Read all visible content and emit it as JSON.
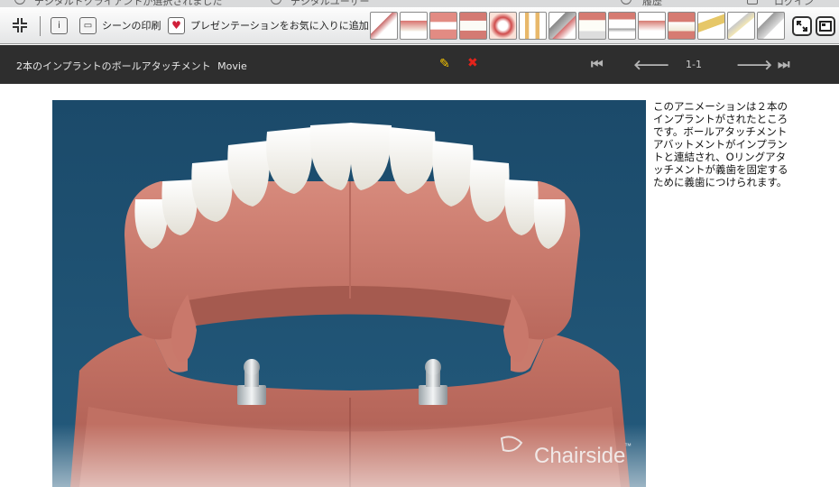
{
  "status_bar": {
    "left_text": "デジタルドクライアントが選択されました",
    "user_text": "デジタルユーザー",
    "history_text": "履歴",
    "login_text": "ログイン"
  },
  "toolbar": {
    "print_label": "シーンの印刷",
    "favorite_label": "プレゼンテーションをお気に入りに追加",
    "thumbnail_icons": [
      "dental-scene-1",
      "dental-scene-2",
      "dental-scene-3",
      "dental-scene-4",
      "dental-scene-5",
      "dental-scene-6",
      "dental-scene-7",
      "dental-scene-8",
      "dental-scene-9",
      "dental-scene-10",
      "dental-scene-11",
      "dental-scene-12",
      "dental-scene-13",
      "dental-scene-14"
    ]
  },
  "titlebar": {
    "title": "2本のインプラントのボールアタッチメント",
    "type": "Movie",
    "pager": "1-1"
  },
  "video": {
    "watermark": "Chairside",
    "trademark": "™"
  },
  "description": "このアニメーションは２本のインプラントがされたところです。ボールアタッチメントアバットメントがインプラントと連結され、Oリングアタッチメントが義歯を固定するために義歯につけられます。",
  "colors": {
    "titlebar_bg": "#2e2e2e",
    "video_bg": "#1e4f6e",
    "gum": "#c9786b",
    "teeth": "#f3f1ea",
    "pencil": "#f5c400",
    "delete": "#e3231b"
  }
}
